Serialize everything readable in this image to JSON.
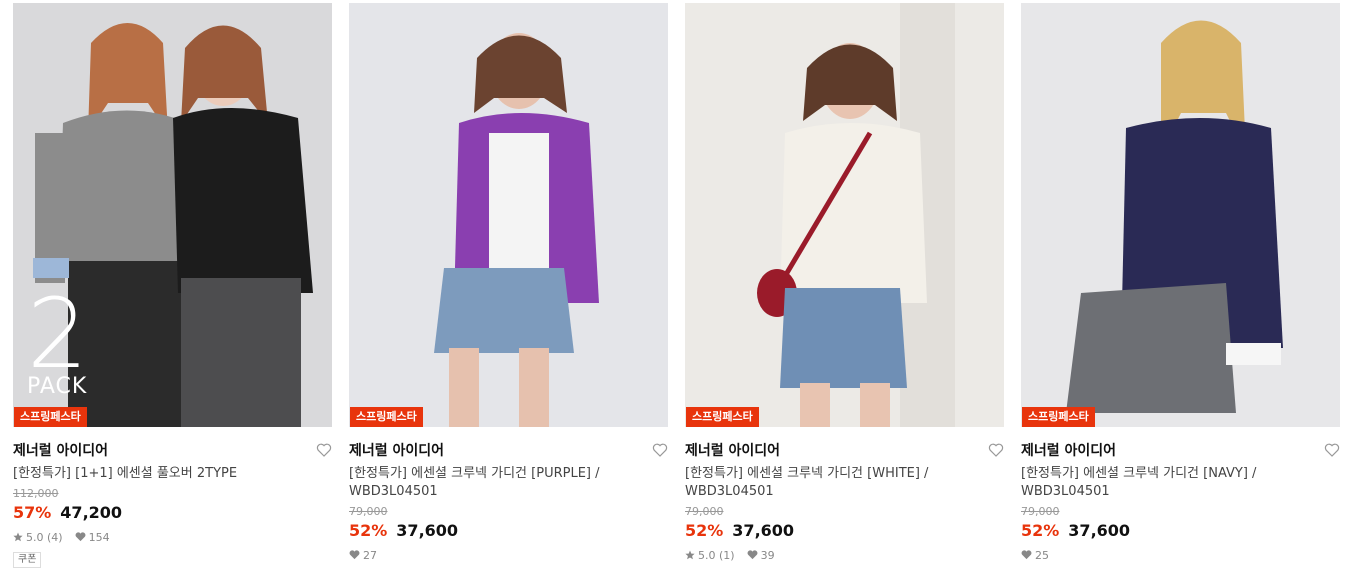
{
  "products": [
    {
      "badge": "스프링페스타",
      "brand": "제너럴 아이디어",
      "title": "[한정특가] [1+1] 에센셜 풀오버 2TYPE",
      "original_price": "112,000",
      "discount": "57%",
      "price": "47,200",
      "rating": "5.0 (4)",
      "likes": "154",
      "pack_number": "2",
      "pack_label": "PACK",
      "extra_tag": "쿠폰"
    },
    {
      "badge": "스프링페스타",
      "brand": "제너럴 아이디어",
      "title": "[한정특가] 에센셜 크루넥 가디건 [PURPLE] / WBD3L04501",
      "original_price": "79,000",
      "discount": "52%",
      "price": "37,600",
      "likes": "27"
    },
    {
      "badge": "스프링페스타",
      "brand": "제너럴 아이디어",
      "title": "[한정특가] 에센셜 크루넥 가디건 [WHITE] / WBD3L04501",
      "original_price": "79,000",
      "discount": "52%",
      "price": "37,600",
      "rating": "5.0 (1)",
      "likes": "39"
    },
    {
      "badge": "스프링페스타",
      "brand": "제너럴 아이디어",
      "title": "[한정특가] 에센셜 크루넥 가디건 [NAVY] / WBD3L04501",
      "original_price": "79,000",
      "discount": "52%",
      "price": "37,600",
      "likes": "25"
    }
  ],
  "colors": {
    "badge": "#e8340c",
    "discount": "#e8340c",
    "purple_cardigan": "#8a3fb0",
    "white_cardigan": "#f3f0e9",
    "navy_cardigan": "#2a2a55"
  }
}
